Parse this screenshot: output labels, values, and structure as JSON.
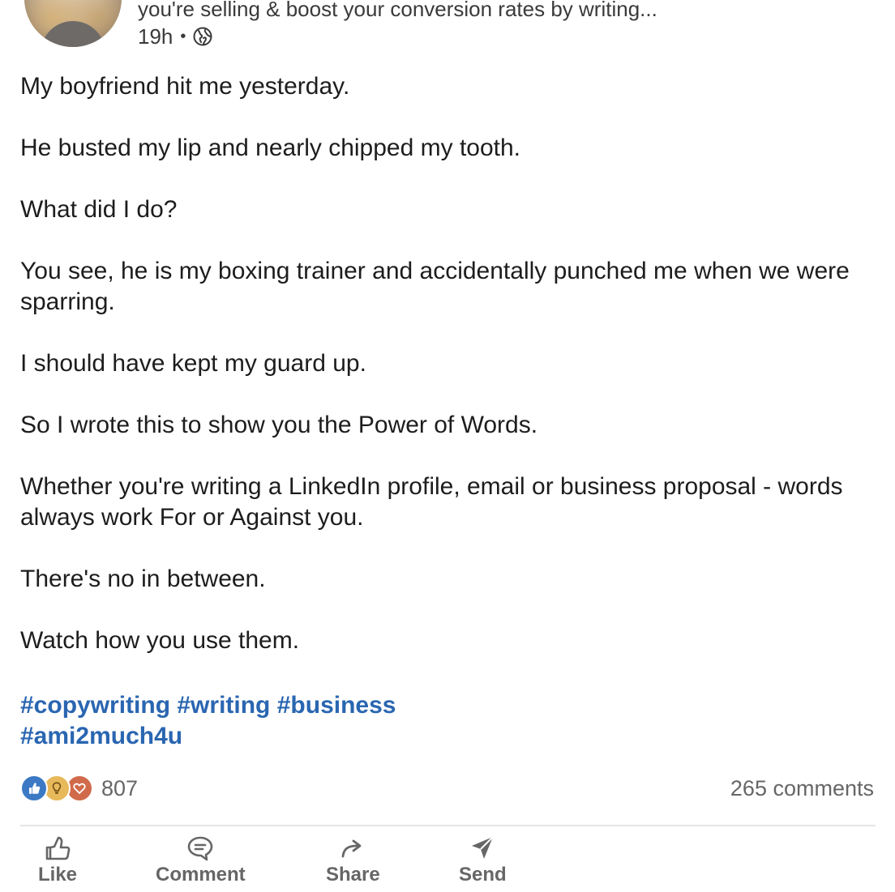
{
  "post": {
    "author_headline_tail": "you're selling & boost your conversion rates by writing...",
    "time_ago": "19h",
    "separator": "•",
    "visibility_icon": "globe-icon",
    "paragraphs": [
      "My boyfriend hit me yesterday.",
      "He busted my lip and nearly chipped my tooth.",
      "What did I do?",
      "You see, he is my boxing trainer and accidentally punched me when we were sparring.",
      "I should have kept my guard up.",
      "So I wrote this to show you the Power of Words.",
      "Whether you're writing a LinkedIn profile, email or business proposal - words always work For or Against you.",
      "There's no in between.",
      "Watch how you use them."
    ],
    "hashtags": [
      "#copywriting",
      "#writing",
      "#business",
      "#ami2much4u"
    ]
  },
  "social": {
    "reaction_icons": [
      "like-icon",
      "insightful-icon",
      "love-icon"
    ],
    "reaction_count": "807",
    "comments_count": "265 comments"
  },
  "actions": [
    {
      "label": "Like",
      "icon": "thumbs-up-icon"
    },
    {
      "label": "Comment",
      "icon": "comment-icon"
    },
    {
      "label": "Share",
      "icon": "share-arrow-icon"
    },
    {
      "label": "Send",
      "icon": "send-icon"
    }
  ],
  "colors": {
    "hashtag": "#2a66b1",
    "like_reaction": "#3b79c4",
    "insight_reaction": "#e8b95a",
    "love_reaction": "#d16a4a",
    "muted_text": "#666666"
  }
}
